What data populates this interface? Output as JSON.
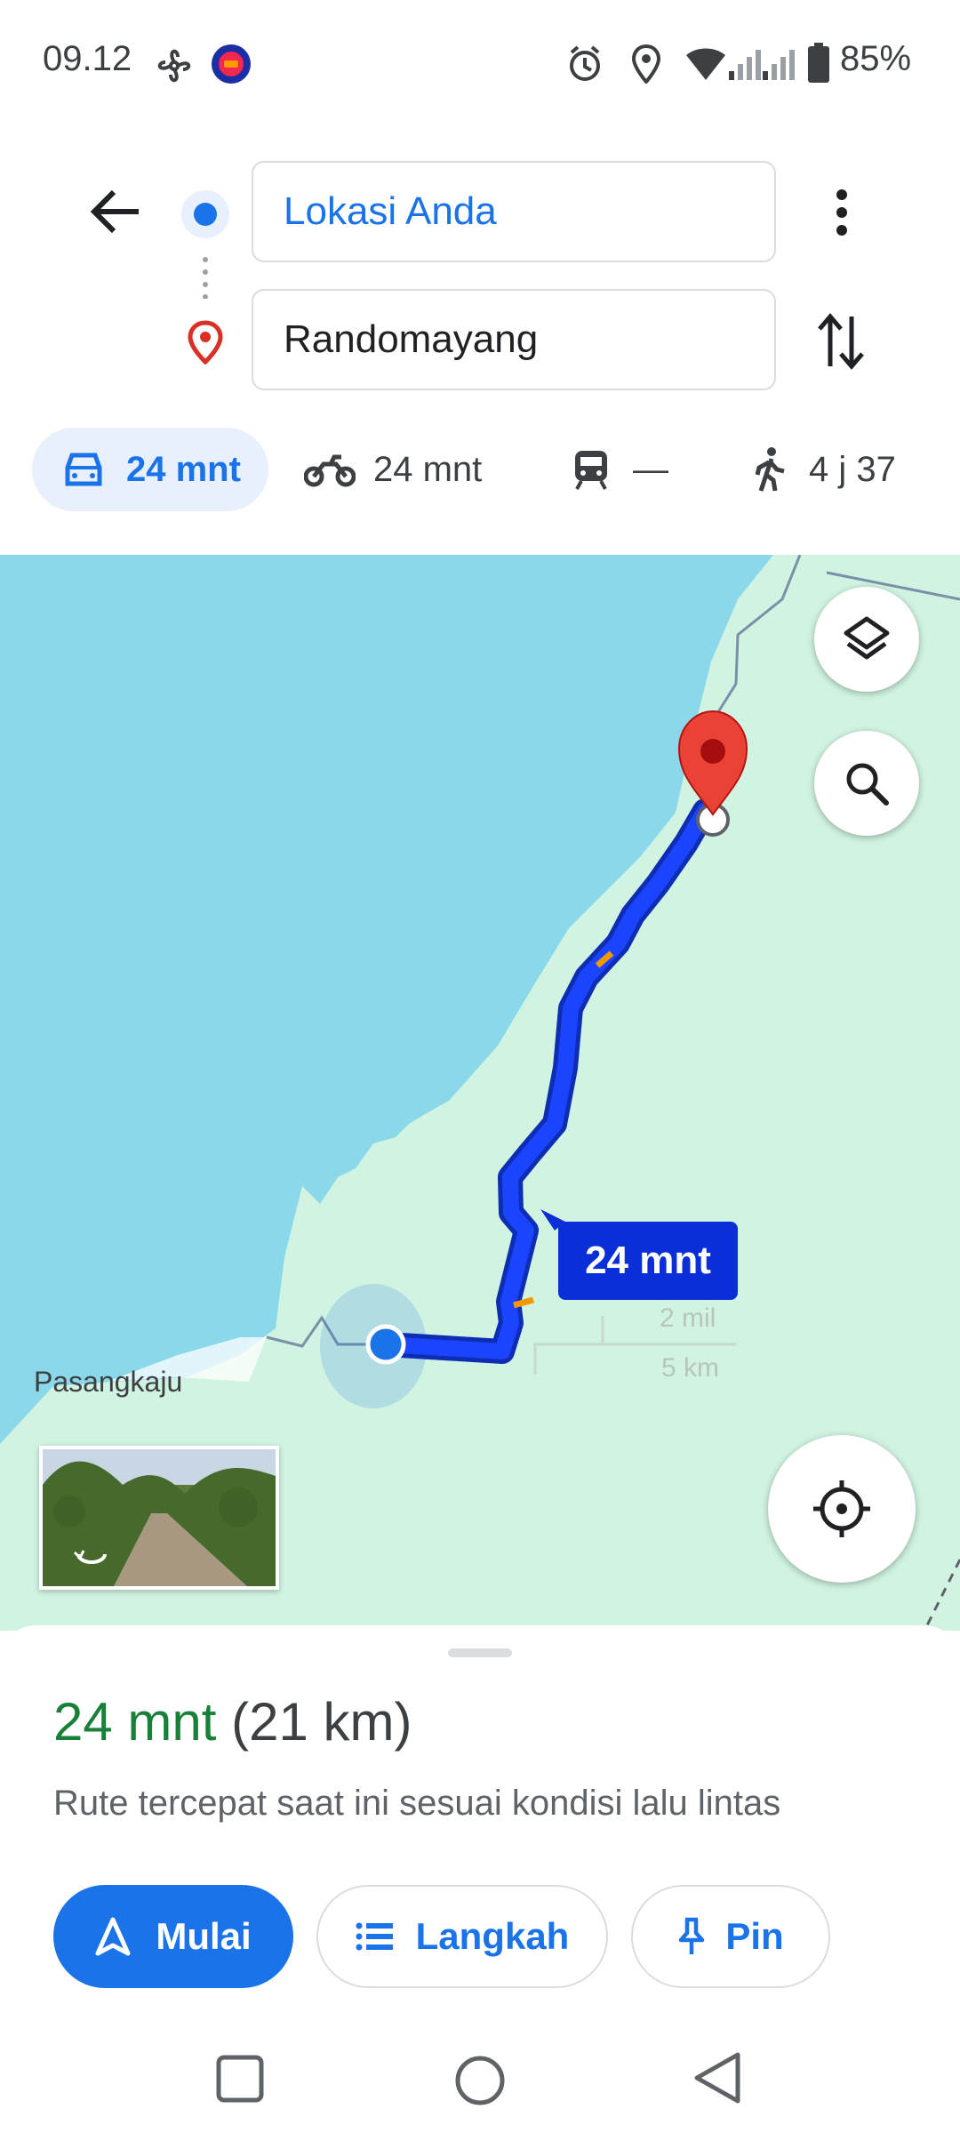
{
  "status_bar": {
    "time": "09.12",
    "battery_percent": "85%",
    "icons": [
      "fan-icon",
      "lazada-app-icon",
      "alarm-icon",
      "location-icon",
      "wifi-icon",
      "signal-icon",
      "signal-icon",
      "battery-icon"
    ]
  },
  "directions": {
    "origin": "Lokasi Anda",
    "destination": "Randomayang"
  },
  "modes": [
    {
      "icon": "car-icon",
      "label": "24 mnt",
      "selected": true
    },
    {
      "icon": "motorcycle-icon",
      "label": "24 mnt"
    },
    {
      "icon": "train-icon",
      "label": "—"
    },
    {
      "icon": "walk-icon",
      "label": "4 j 37"
    }
  ],
  "map": {
    "route_label": "24 mnt",
    "place_label": "Pasangkaju",
    "scale_primary": "2 mil",
    "scale_secondary": "5 km",
    "colors": {
      "water": "#8bd8ea",
      "land": "#d1f3e1",
      "route": "#1a44ff"
    }
  },
  "sheet": {
    "duration": "24 mnt",
    "distance": "(21 km)",
    "description": "Rute tercepat saat ini sesuai kondisi lalu lintas",
    "start_label": "Mulai",
    "steps_label": "Langkah",
    "pin_label": "Pin"
  },
  "accent_color": "#1a73e8"
}
